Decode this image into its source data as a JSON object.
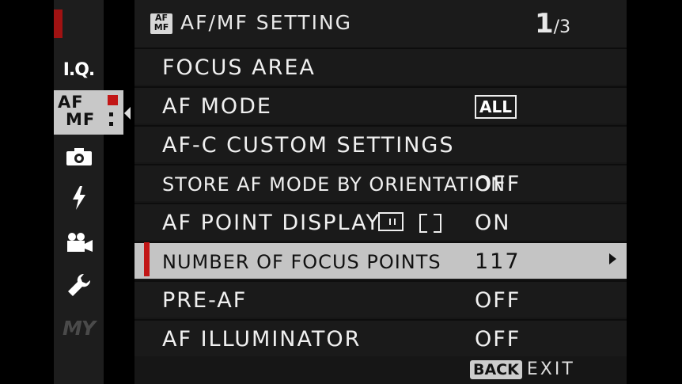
{
  "sidebar": {
    "iq_label": "I.Q.",
    "afmf_label_top": "AF",
    "afmf_label_bottom": "MF",
    "my_label": "MY",
    "icons": [
      "camera-icon",
      "flash-icon",
      "movie-icon",
      "wrench-icon"
    ],
    "accent": "#c21616"
  },
  "header": {
    "icon_top": "AF",
    "icon_bottom": "MF",
    "title": "AF/MF SETTING",
    "page_current": "1",
    "page_total": "/3"
  },
  "menu": {
    "items": [
      {
        "label": "FOCUS AREA",
        "value": ""
      },
      {
        "label": "AF MODE",
        "value": "ALL"
      },
      {
        "label": "AF-C CUSTOM SETTINGS",
        "value": ""
      },
      {
        "label": "STORE AF MODE BY ORIENTATION",
        "value": "OFF"
      },
      {
        "label": "AF POINT DISPLAY",
        "value": "ON"
      },
      {
        "label": "NUMBER OF FOCUS POINTS",
        "value": "117",
        "selected": true
      },
      {
        "label": "PRE-AF",
        "value": "OFF"
      },
      {
        "label": "AF ILLUMINATOR",
        "value": "OFF"
      }
    ]
  },
  "footer": {
    "back_label": "BACK",
    "exit_label": "EXIT"
  }
}
